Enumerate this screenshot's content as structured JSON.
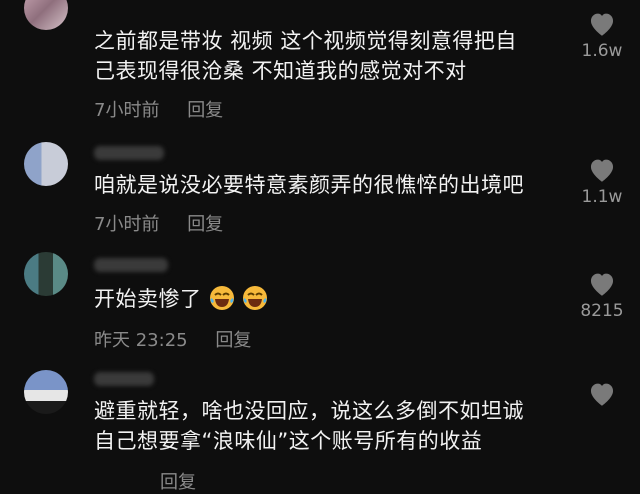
{
  "comments": [
    {
      "lines": [
        "之前都是带妆 视频 这个视频觉得刻意得把自",
        "己表现得很沧桑 不知道我的感觉对不对"
      ],
      "time": "7小时前",
      "reply_label": "回复",
      "likes": "1.6w"
    },
    {
      "lines": [
        "咱就是说没必要特意素颜弄的很憔悴的出境吧"
      ],
      "time": "7小时前",
      "reply_label": "回复",
      "likes": "1.1w"
    },
    {
      "lines": [
        "开始卖惨了"
      ],
      "emoji": "laughing-tears-emoji",
      "time": "昨天 23:25",
      "reply_label": "回复",
      "likes": "8215"
    },
    {
      "lines": [
        "避重就轻，啥也没回应，说这么多倒不如坦诚",
        "自己想要拿“浪味仙”这个账号所有的收益"
      ],
      "time": "",
      "reply_label": "回复",
      "likes": ""
    }
  ],
  "icons": {
    "like": "heart-icon"
  },
  "colors": {
    "background": "#0e0e0e",
    "text": "#f2f2f2",
    "meta": "#8a8a8a",
    "heart": "#7a7a7a"
  }
}
